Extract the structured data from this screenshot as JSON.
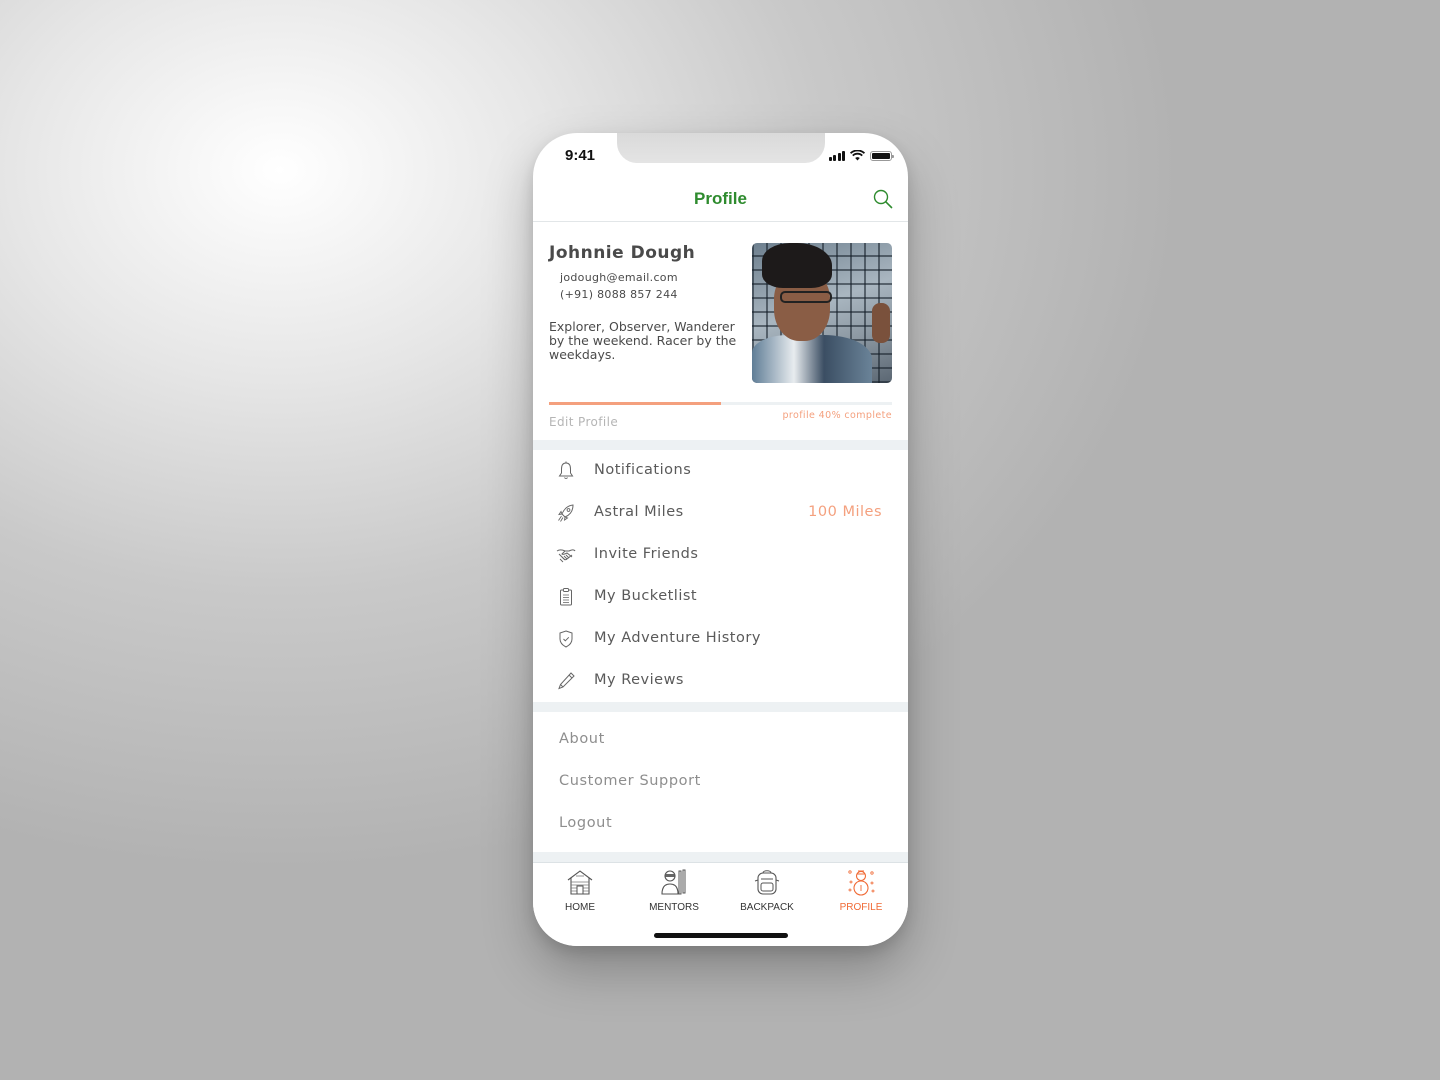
{
  "status_bar": {
    "time": "9:41",
    "icons": [
      "signal-icon",
      "wifi-icon",
      "battery-icon"
    ]
  },
  "header": {
    "title": "Profile",
    "search_icon": "search-icon"
  },
  "colors": {
    "brand_green": "#2e8b2e",
    "accent_orange": "#f4a07e",
    "active_tab": "#f06a35"
  },
  "profile": {
    "name": "Johnnie Dough",
    "email": "jodough@email.com",
    "phone": "(+91) 8088 857 244",
    "bio": "Explorer, Observer, Wanderer by the weekend. Racer by the weekdays.",
    "edit_label": "Edit Profile",
    "completion_label": "profile 40% complete",
    "completion_percent": 40,
    "bar_fill_fraction": 0.5
  },
  "menu": [
    {
      "label": "Notifications",
      "icon": "bell-icon",
      "value": ""
    },
    {
      "label": "Astral Miles",
      "icon": "rocket-icon",
      "value": "100 Miles"
    },
    {
      "label": "Invite Friends",
      "icon": "handshake-icon",
      "value": ""
    },
    {
      "label": "My Bucketlist",
      "icon": "clipboard-icon",
      "value": ""
    },
    {
      "label": "My Adventure History",
      "icon": "shield-check-icon",
      "value": ""
    },
    {
      "label": "My Reviews",
      "icon": "pencil-icon",
      "value": ""
    }
  ],
  "secondary_menu": [
    {
      "label": "About"
    },
    {
      "label": "Customer Support"
    },
    {
      "label": "Logout"
    }
  ],
  "tabbar": [
    {
      "label": "HOME",
      "icon": "cabin-icon",
      "active": false
    },
    {
      "label": "MENTORS",
      "icon": "skier-icon",
      "active": false
    },
    {
      "label": "BACKPACK",
      "icon": "backpack-icon",
      "active": false
    },
    {
      "label": "PROFILE",
      "icon": "snowman-icon",
      "active": true
    }
  ]
}
